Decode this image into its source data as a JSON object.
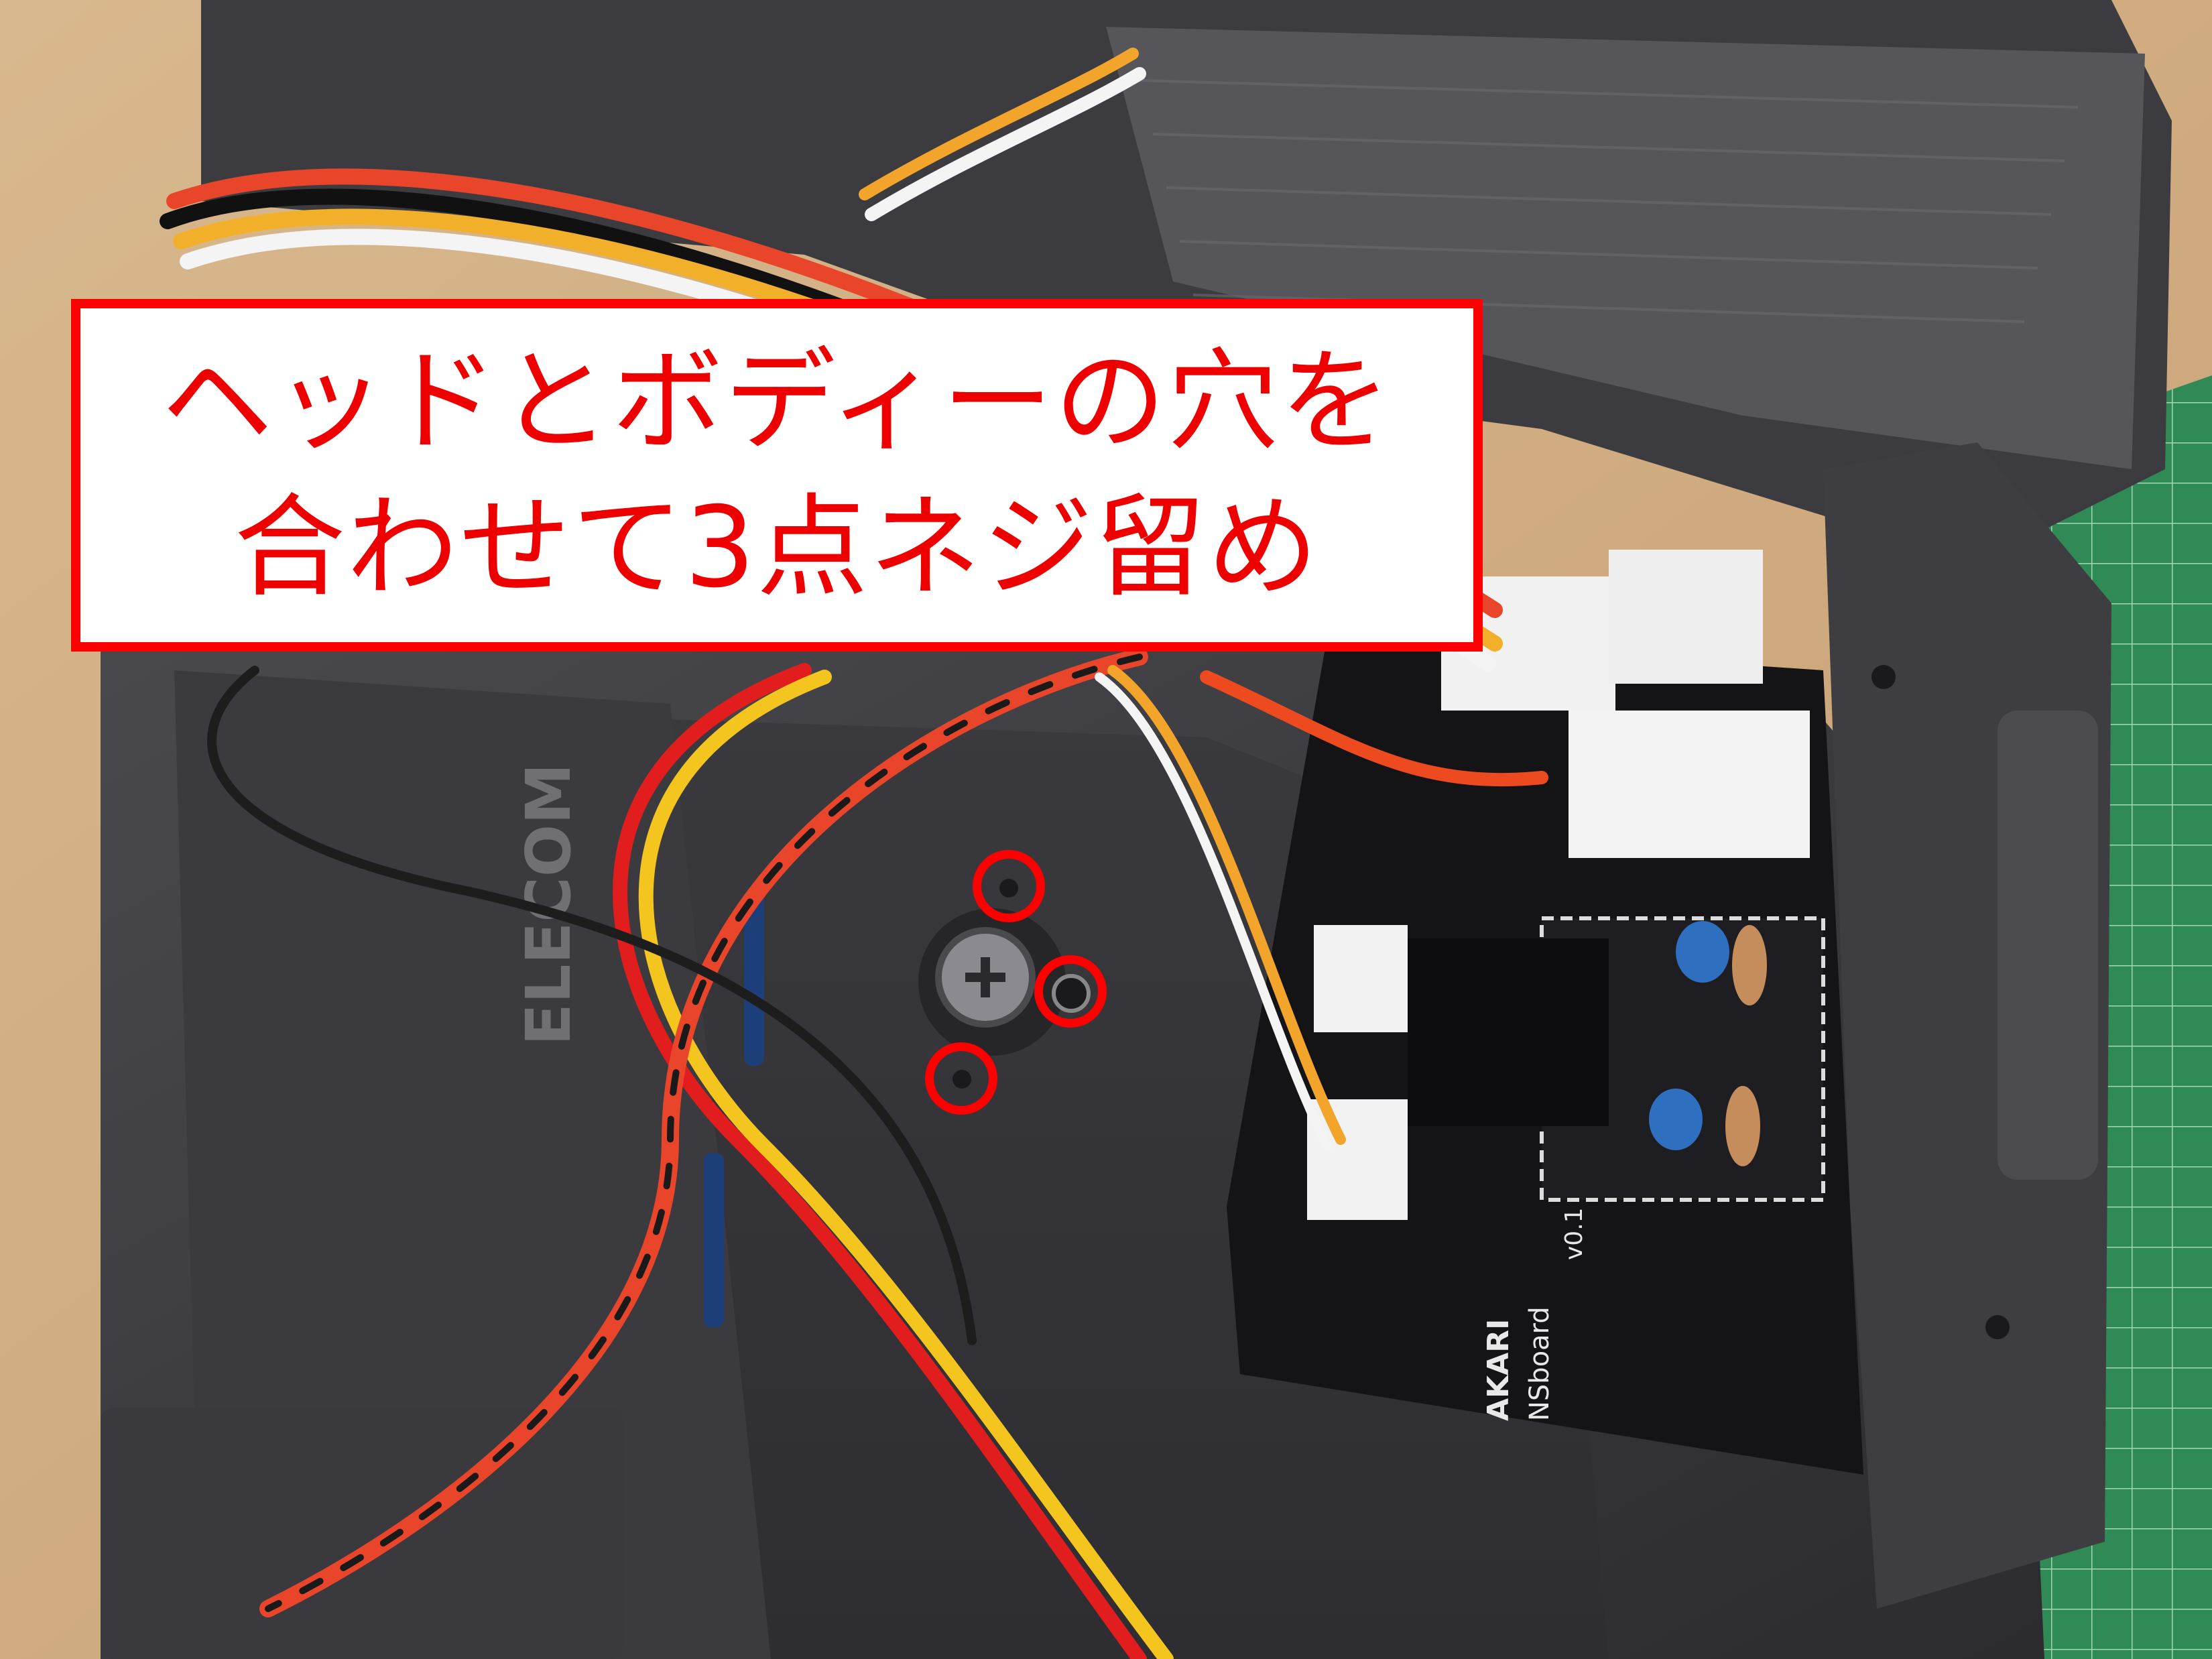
{
  "caption": {
    "line1": "ヘッドとボディーの穴を",
    "line2": "合わせて3点ネジ留め"
  },
  "photo": {
    "case_label": "ELECOM",
    "board_label_1": "AKARI",
    "board_label_2": "NSboard",
    "board_label_3": "v0.1"
  },
  "colors": {
    "caption_text": "#ee0000",
    "caption_border": "#ff0000",
    "marker": "#ff0000"
  }
}
